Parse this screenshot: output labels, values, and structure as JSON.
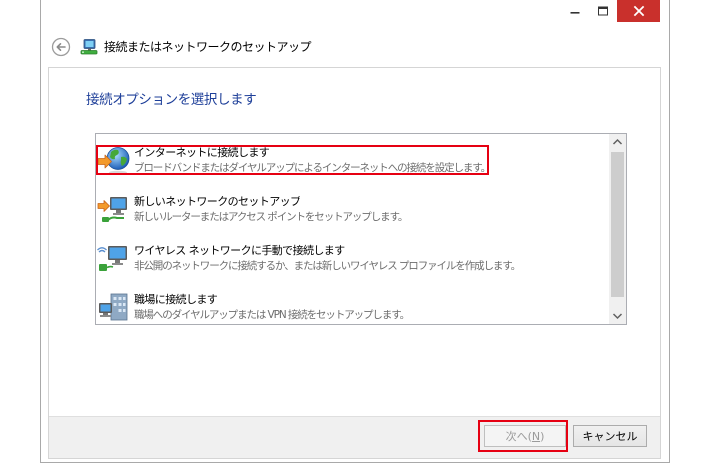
{
  "window": {
    "minimize_icon": "minimize-icon",
    "maximize_icon": "maximize-icon",
    "close_icon": "close-icon",
    "close_button_color": "#c9302c"
  },
  "header": {
    "back_icon": "back-arrow-icon",
    "app_icon": "network-setup-icon",
    "title": "接続またはネットワークのセットアップ"
  },
  "content": {
    "heading": "接続オプションを選択します",
    "heading_color": "#1e3f99",
    "options": [
      {
        "icon": "internet-globe-icon",
        "title": "インターネットに接続します",
        "description": "ブロードバンドまたはダイヤルアップによるインターネットへの接続を設定します。",
        "highlighted": true
      },
      {
        "icon": "new-network-icon",
        "title": "新しいネットワークのセットアップ",
        "description": "新しいルーターまたはアクセス ポイントをセットアップします。",
        "highlighted": false
      },
      {
        "icon": "wireless-network-icon",
        "title": "ワイヤレス ネットワークに手動で接続します",
        "description": "非公開のネットワークに接続するか、または新しいワイヤレス プロファイルを作成します。",
        "highlighted": false
      },
      {
        "icon": "workplace-building-icon",
        "title": "職場に接続します",
        "description": "職場へのダイヤルアップまたは VPN 接続をセットアップします。",
        "highlighted": false
      }
    ],
    "scrollbar": {
      "up_icon": "chevron-up-icon",
      "down_icon": "chevron-down-icon"
    }
  },
  "footer": {
    "next": {
      "label": "次へ(",
      "accelerator": "N",
      "suffix": ")",
      "enabled": false,
      "highlighted": true
    },
    "cancel": {
      "label": "キャンセル"
    }
  },
  "annotations": {
    "color": "#e60012"
  }
}
